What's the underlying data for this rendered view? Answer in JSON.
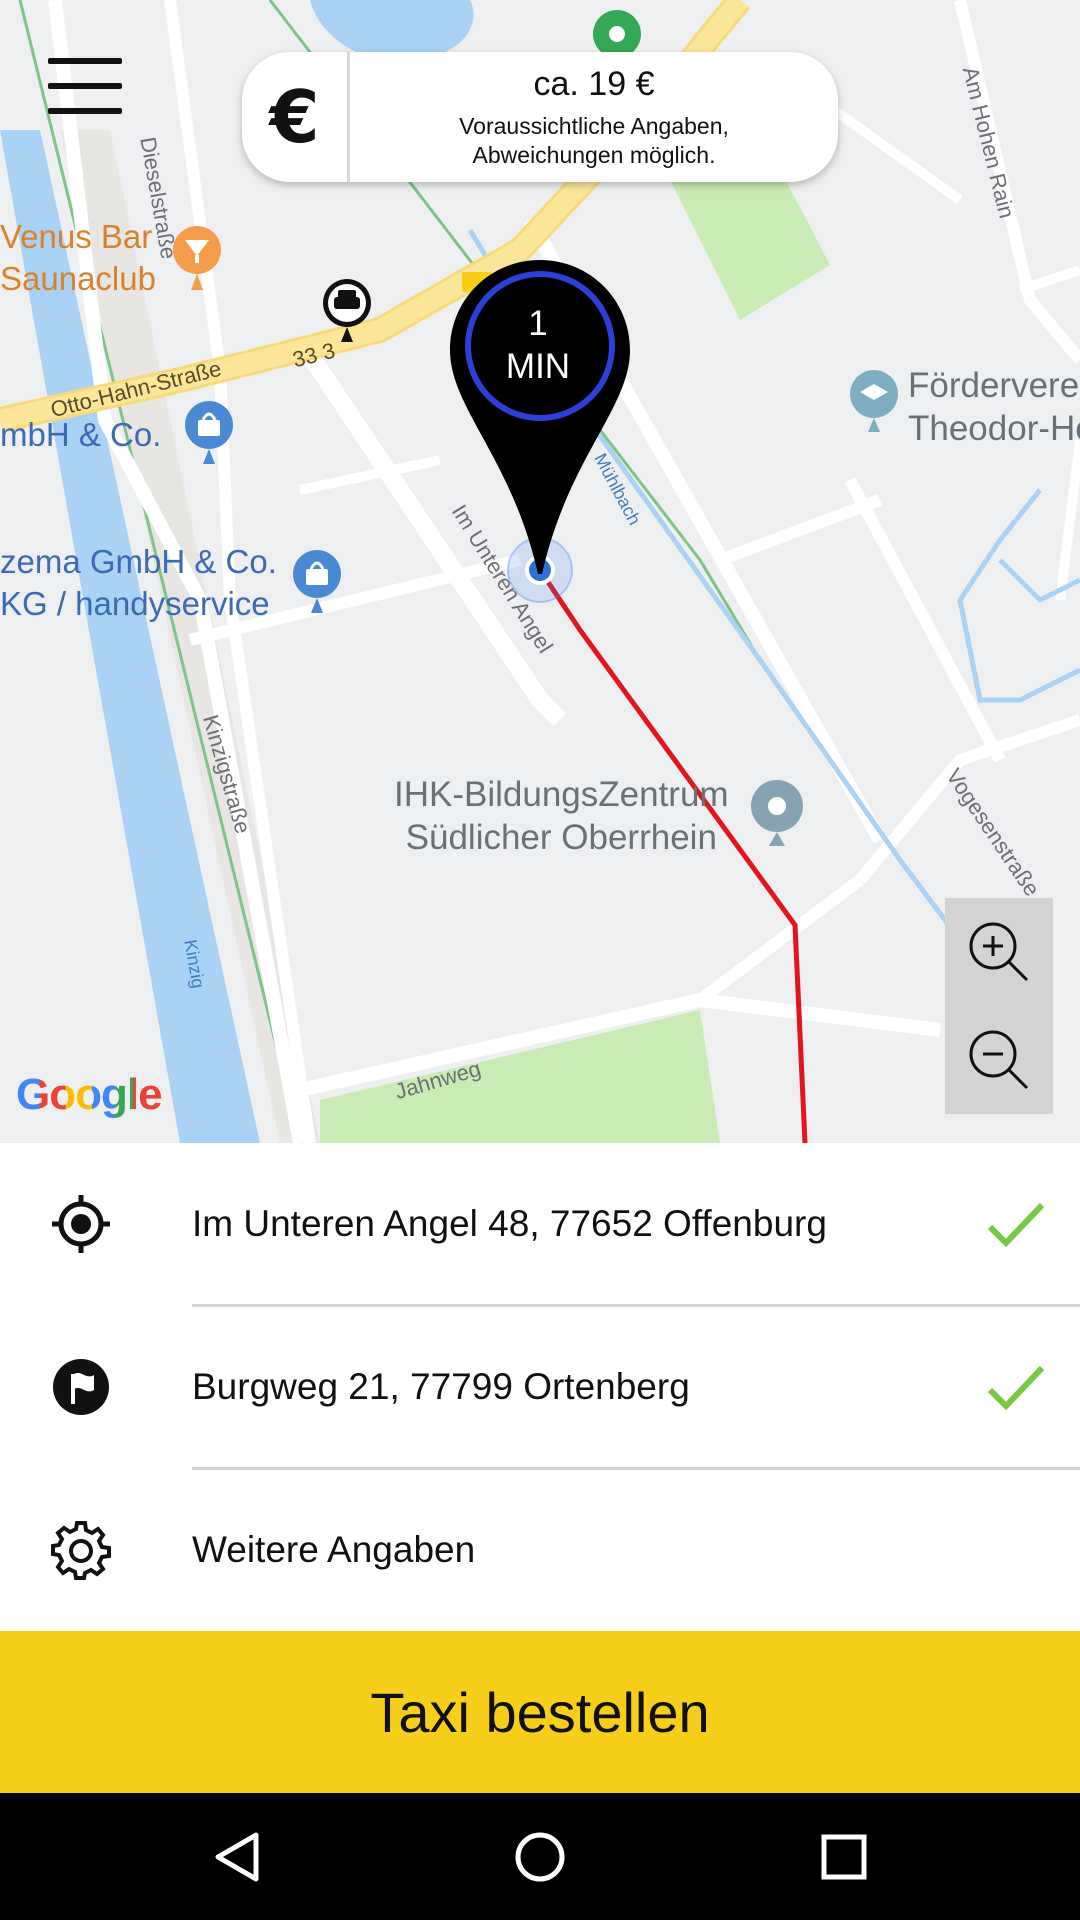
{
  "menu": {
    "icon": "hamburger-menu-icon"
  },
  "price_card": {
    "currency_symbol": "€",
    "price": "ca. 19 €",
    "note": "Voraussichtliche Angaben, Abweichungen möglich."
  },
  "eta": {
    "value": "1",
    "unit": "MIN"
  },
  "map": {
    "pois": {
      "venus_bar": [
        "Venus Bar",
        "Saunaclub"
      ],
      "mbh": "mbH & Co.",
      "zema": [
        "zema GmbH & Co.",
        "KG / handyservice"
      ],
      "ihk": [
        "IHK-BildungsZentrum",
        "Südlicher Oberrhein"
      ],
      "foerder": [
        "Fördervere",
        "Theodor-He"
      ]
    },
    "streets": {
      "dieselstrasse": "Dieselstraße",
      "otto_hahn": "Otto-Hahn-Straße",
      "road_number": "33 3",
      "im_unteren_angel": "Im Unteren Angel",
      "muehlbach": "Mühlbach",
      "kinzigstrasse": "Kinzigstraße",
      "kinzig": "Kinzig",
      "jahnweg": "Jahnweg",
      "am_hohen_rain": "Am Hohen Rain",
      "vogesenstrasse": "Vogesenstraße"
    },
    "attribution": "Google",
    "colors": {
      "route": "#e0161c",
      "water": "#a9d2f5",
      "park": "#c8ecb4",
      "major_road": "#fbe69a"
    }
  },
  "zoom": {
    "in_icon": "zoom-in-icon",
    "out_icon": "zoom-out-icon"
  },
  "pickup": {
    "address": "Im Unteren Angel 48, 77652 Offenburg",
    "icon": "crosshair-location-icon",
    "status_icon": "check-icon"
  },
  "destination": {
    "address": "Burgweg 21, 77799 Ortenberg",
    "icon": "flag-icon",
    "status_icon": "check-icon"
  },
  "more": {
    "label": "Weitere Angaben",
    "icon": "gear-icon"
  },
  "order_button": {
    "label": "Taxi bestellen",
    "color": "#f7cf1b"
  },
  "navbar": {
    "back_icon": "back-icon",
    "home_icon": "home-icon",
    "recents_icon": "recents-icon"
  }
}
